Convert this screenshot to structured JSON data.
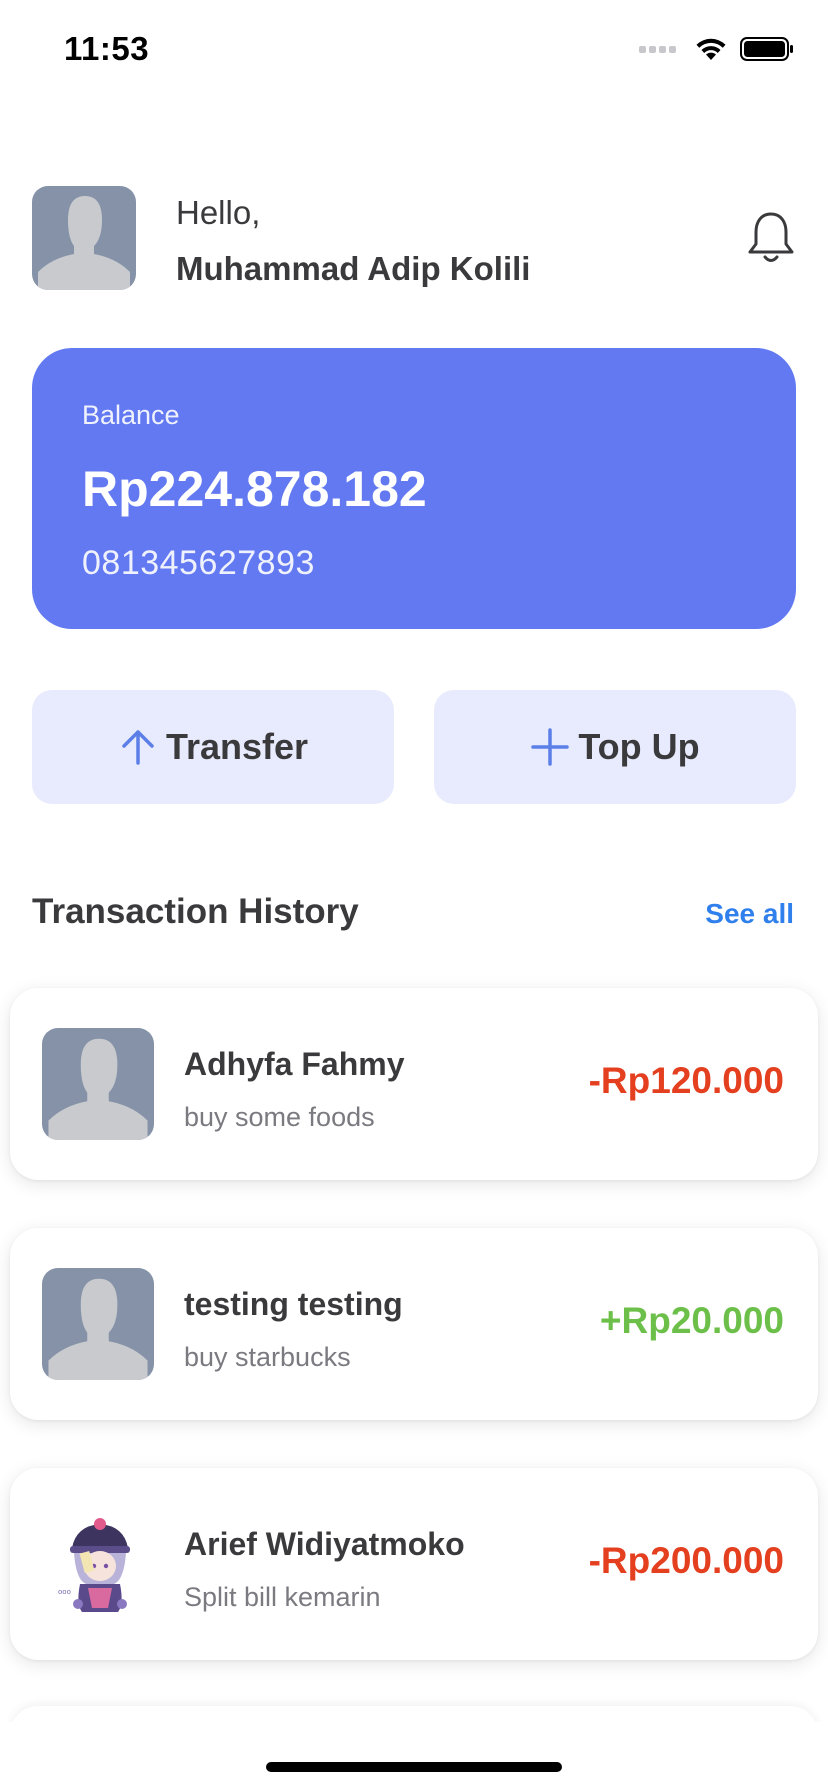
{
  "status_bar": {
    "time": "11:53",
    "icons": [
      "signal-icon",
      "wifi-icon",
      "battery-icon"
    ]
  },
  "header": {
    "greeting": "Hello,",
    "user_name": "Muhammad Adip Kolili",
    "avatar_icon": "default-avatar-icon",
    "notification_icon": "bell-icon"
  },
  "balance_card": {
    "label": "Balance",
    "amount": "Rp224.878.182",
    "phone": "081345627893",
    "background_color": "#6279f2"
  },
  "actions": {
    "transfer_label": "Transfer",
    "transfer_icon": "arrow-up-icon",
    "topup_label": "Top Up",
    "topup_icon": "plus-icon",
    "button_bg_color": "#e8ebfd",
    "icon_color": "#5b7fe6"
  },
  "history": {
    "title": "Transaction History",
    "see_all_label": "See all",
    "transactions": [
      {
        "name": "Adhyfa Fahmy",
        "note": "buy some foods",
        "amount": "-Rp120.000",
        "direction": "out",
        "avatar": "default-avatar-icon"
      },
      {
        "name": "testing testing",
        "note": "buy starbucks",
        "amount": "+Rp20.000",
        "direction": "in",
        "avatar": "default-avatar-icon"
      },
      {
        "name": "Arief Widiyatmoko",
        "note": "Split bill kemarin",
        "amount": "-Rp200.000",
        "direction": "out",
        "avatar": "anime-character-avatar"
      }
    ]
  },
  "colors": {
    "negative_amount": "#e4401f",
    "positive_amount": "#6cc04a",
    "link": "#2f80ed"
  }
}
